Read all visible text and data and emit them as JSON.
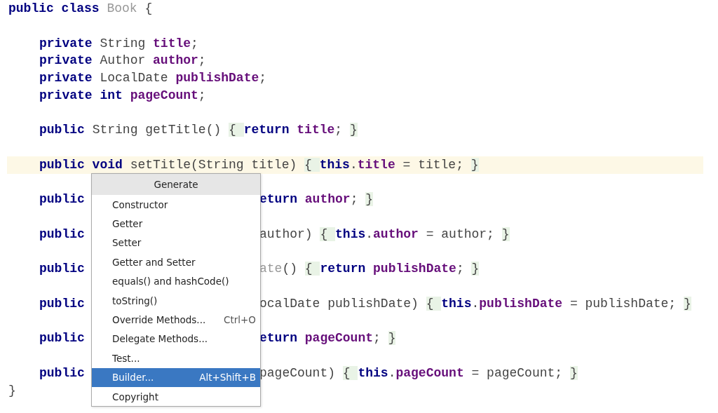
{
  "editor": {
    "lines": [
      {
        "kind": "top",
        "current": false,
        "tokens": [
          {
            "t": "public class ",
            "kind": "kw"
          },
          {
            "t": "Book",
            "kind": "name"
          },
          {
            "t": " {",
            "kind": "plain"
          }
        ]
      },
      {
        "kind": "blank",
        "current": false
      },
      {
        "kind": "member",
        "current": false,
        "tokens": [
          {
            "t": "private ",
            "kind": "kw"
          },
          {
            "t": "String ",
            "kind": "plain"
          },
          {
            "t": "title",
            "kind": "field"
          },
          {
            "t": ";",
            "kind": "plain"
          }
        ]
      },
      {
        "kind": "member",
        "current": false,
        "tokens": [
          {
            "t": "private ",
            "kind": "kw"
          },
          {
            "t": "Author ",
            "kind": "plain"
          },
          {
            "t": "author",
            "kind": "field"
          },
          {
            "t": ";",
            "kind": "plain"
          }
        ]
      },
      {
        "kind": "member",
        "current": false,
        "tokens": [
          {
            "t": "private ",
            "kind": "kw"
          },
          {
            "t": "LocalDate ",
            "kind": "plain"
          },
          {
            "t": "publishDate",
            "kind": "field"
          },
          {
            "t": ";",
            "kind": "plain"
          }
        ]
      },
      {
        "kind": "member",
        "current": false,
        "tokens": [
          {
            "t": "private int ",
            "kind": "kw"
          },
          {
            "t": "pageCount",
            "kind": "field"
          },
          {
            "t": ";",
            "kind": "plain"
          }
        ]
      },
      {
        "kind": "blank",
        "current": false
      },
      {
        "kind": "member",
        "current": false,
        "tokens": [
          {
            "t": "public ",
            "kind": "kw"
          },
          {
            "t": "String getTitle() ",
            "kind": "plain"
          },
          {
            "t": "{ ",
            "kind": "fold"
          },
          {
            "t": "return ",
            "kind": "kw"
          },
          {
            "t": "title",
            "kind": "field"
          },
          {
            "t": "; ",
            "kind": "plain"
          },
          {
            "t": "}",
            "kind": "fold"
          }
        ]
      },
      {
        "kind": "blank",
        "current": false
      },
      {
        "kind": "member",
        "current": true,
        "tokens": [
          {
            "t": "public void ",
            "kind": "kw"
          },
          {
            "t": "setTitle(String title) ",
            "kind": "plain"
          },
          {
            "t": "{ ",
            "kind": "fold"
          },
          {
            "t": "this",
            "kind": "kw"
          },
          {
            "t": ".",
            "kind": "plain"
          },
          {
            "t": "title",
            "kind": "field"
          },
          {
            "t": " = title; ",
            "kind": "plain"
          },
          {
            "t": "}",
            "kind": "fold"
          }
        ]
      },
      {
        "kind": "blank",
        "current": false
      },
      {
        "kind": "split",
        "current": false,
        "left": [
          {
            "t": "public",
            "kind": "kw"
          }
        ],
        "right": [
          {
            "t": "eturn ",
            "kind": "kw"
          },
          {
            "t": "author",
            "kind": "field"
          },
          {
            "t": "; ",
            "kind": "plain"
          },
          {
            "t": "}",
            "kind": "fold"
          }
        ]
      },
      {
        "kind": "blank",
        "current": false
      },
      {
        "kind": "split",
        "current": false,
        "left": [
          {
            "t": "public",
            "kind": "kw"
          }
        ],
        "right": [
          {
            "t": "author) ",
            "kind": "plain"
          },
          {
            "t": "{ ",
            "kind": "fold"
          },
          {
            "t": "this",
            "kind": "kw"
          },
          {
            "t": ".",
            "kind": "plain"
          },
          {
            "t": "author",
            "kind": "field"
          },
          {
            "t": " = author; ",
            "kind": "plain"
          },
          {
            "t": "}",
            "kind": "fold"
          }
        ]
      },
      {
        "kind": "blank",
        "current": false
      },
      {
        "kind": "split",
        "current": false,
        "left": [
          {
            "t": "public",
            "kind": "kw"
          }
        ],
        "right": [
          {
            "t": "ate",
            "kind": "name"
          },
          {
            "t": "() ",
            "kind": "plain"
          },
          {
            "t": "{ ",
            "kind": "fold"
          },
          {
            "t": "return ",
            "kind": "kw"
          },
          {
            "t": "publishDate",
            "kind": "field"
          },
          {
            "t": "; ",
            "kind": "plain"
          },
          {
            "t": "}",
            "kind": "fold"
          }
        ]
      },
      {
        "kind": "blank",
        "current": false
      },
      {
        "kind": "split",
        "current": false,
        "left": [
          {
            "t": "public",
            "kind": "kw"
          }
        ],
        "right": [
          {
            "t": "ocalDate publishDate) ",
            "kind": "plain"
          },
          {
            "t": "{ ",
            "kind": "fold"
          },
          {
            "t": "this",
            "kind": "kw"
          },
          {
            "t": ".",
            "kind": "plain"
          },
          {
            "t": "publishDate",
            "kind": "field"
          },
          {
            "t": " = publishDate; ",
            "kind": "plain"
          },
          {
            "t": "}",
            "kind": "fold"
          }
        ]
      },
      {
        "kind": "blank",
        "current": false
      },
      {
        "kind": "split",
        "current": false,
        "left": [
          {
            "t": "public",
            "kind": "kw"
          }
        ],
        "right": [
          {
            "t": "eturn ",
            "kind": "kw"
          },
          {
            "t": "pageCount",
            "kind": "field"
          },
          {
            "t": "; ",
            "kind": "plain"
          },
          {
            "t": "}",
            "kind": "fold"
          }
        ]
      },
      {
        "kind": "blank",
        "current": false
      },
      {
        "kind": "split",
        "current": false,
        "left": [
          {
            "t": "public",
            "kind": "kw"
          }
        ],
        "right": [
          {
            "t": "pageCount) ",
            "kind": "plain"
          },
          {
            "t": "{ ",
            "kind": "fold"
          },
          {
            "t": "this",
            "kind": "kw"
          },
          {
            "t": ".",
            "kind": "plain"
          },
          {
            "t": "pageCount",
            "kind": "field"
          },
          {
            "t": " = pageCount; ",
            "kind": "plain"
          },
          {
            "t": "}",
            "kind": "fold"
          }
        ]
      },
      {
        "kind": "top",
        "current": false,
        "tokens": [
          {
            "t": "}",
            "kind": "plain"
          }
        ]
      }
    ]
  },
  "generate_menu": {
    "title": "Generate",
    "items": [
      {
        "label": "Constructor",
        "selected": false
      },
      {
        "label": "Getter",
        "selected": false
      },
      {
        "label": "Setter",
        "selected": false
      },
      {
        "label": "Getter and Setter",
        "selected": false
      },
      {
        "label": "equals() and hashCode()",
        "selected": false
      },
      {
        "label": "toString()",
        "selected": false
      },
      {
        "label": "Override Methods...",
        "shortcut": "Ctrl+O",
        "selected": false
      },
      {
        "label": "Delegate Methods...",
        "selected": false
      },
      {
        "label": "Test...",
        "selected": false
      },
      {
        "label": "Builder...",
        "shortcut": "Alt+Shift+B",
        "selected": true
      },
      {
        "label": "Copyright",
        "selected": false
      }
    ]
  }
}
